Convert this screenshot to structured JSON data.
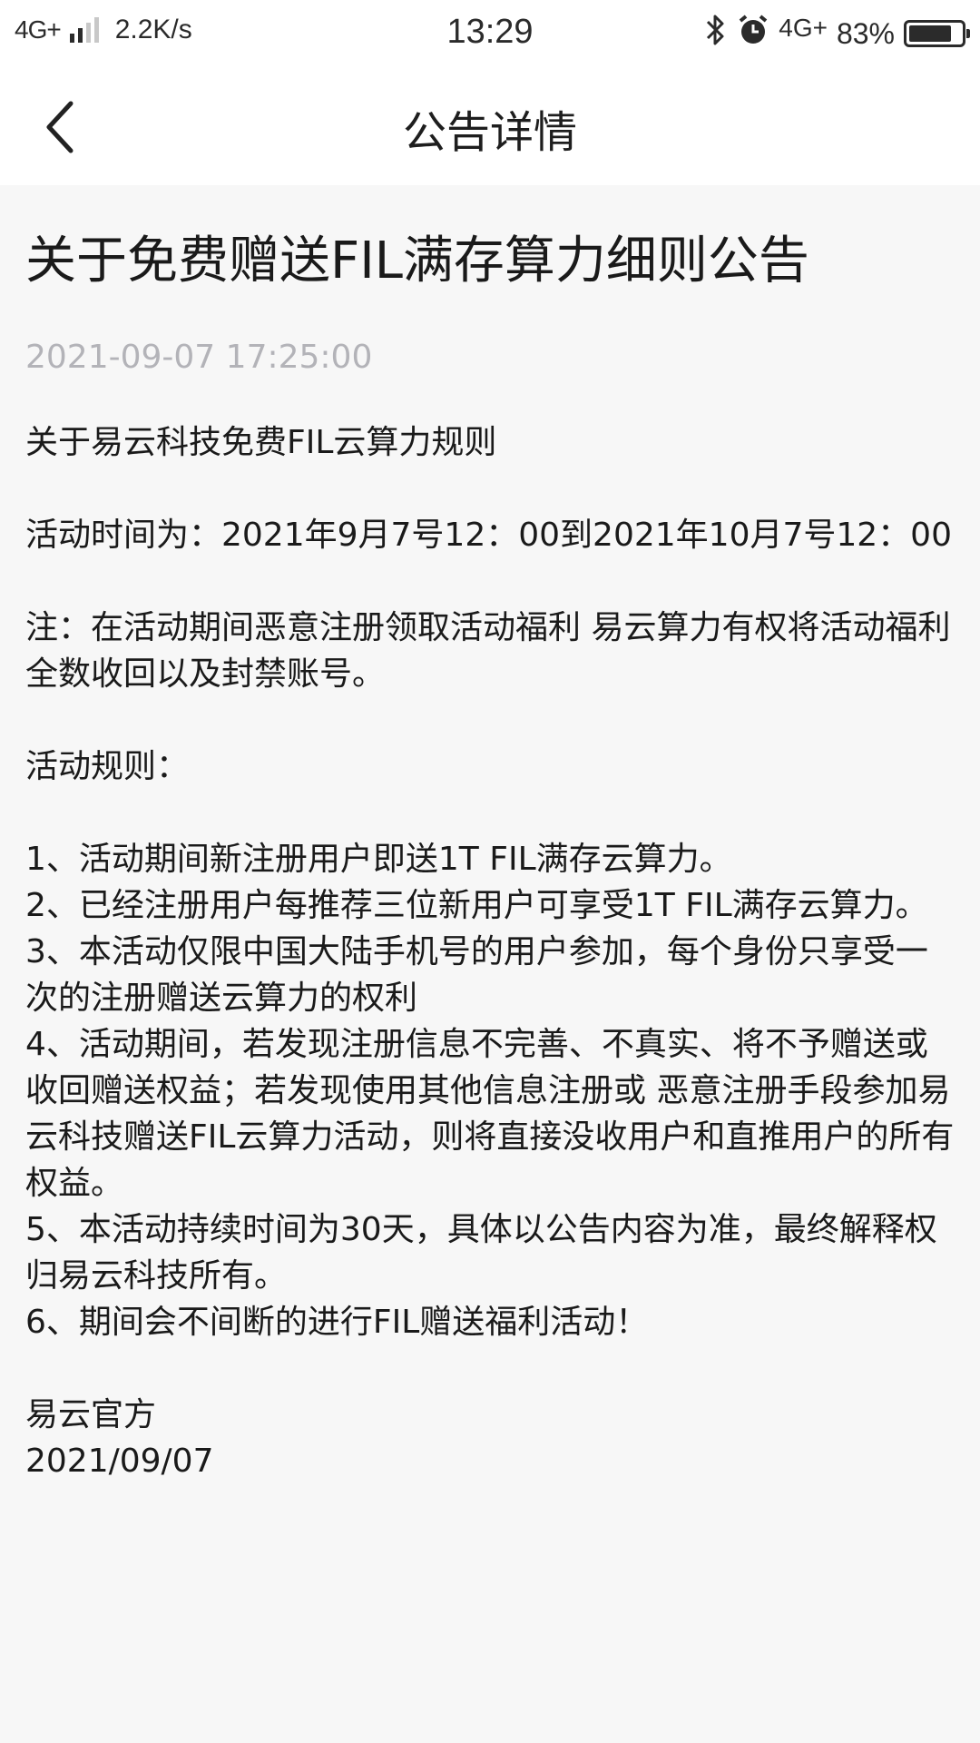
{
  "status_bar": {
    "network": "4G+",
    "speed": "2.2K/s",
    "time": "13:29",
    "network2": "4G+",
    "battery": "83%",
    "battery_level": 0.83
  },
  "header": {
    "title": "公告详情"
  },
  "article": {
    "title": "关于免费赠送FIL满存算力细则公告",
    "datetime": "2021-09-07 17:25:00",
    "intro": "关于易云科技免费FIL云算力规则",
    "period": "活动时间为：2021年9月7号12：00到2021年10月7号12：00",
    "note": "注：在活动期间恶意注册领取活动福利 易云算力有权将活动福利全数收回以及封禁账号。",
    "rules_heading": "活动规则：",
    "rules": [
      "1、活动期间新注册用户即送1T FIL满存云算力。",
      "2、已经注册用户每推荐三位新用户可享受1T FIL满存云算力。",
      "3、本活动仅限中国大陆手机号的用户参加，每个身份只享受一次的注册赠送云算力的权利",
      "4、活动期间，若发现注册信息不完善、不真实、将不予赠送或收回赠送权益；若发现使用其他信息注册或 恶意注册手段参加易云科技赠送FIL云算力活动，则将直接没收用户和直推用户的所有权益。",
      "5、本活动持续时间为30天，具体以公告内容为准，最终解释权归易云科技所有。",
      "6、期间会不间断的进行FIL赠送福利活动！"
    ],
    "signature": "易云官方",
    "date": "2021/09/07"
  }
}
